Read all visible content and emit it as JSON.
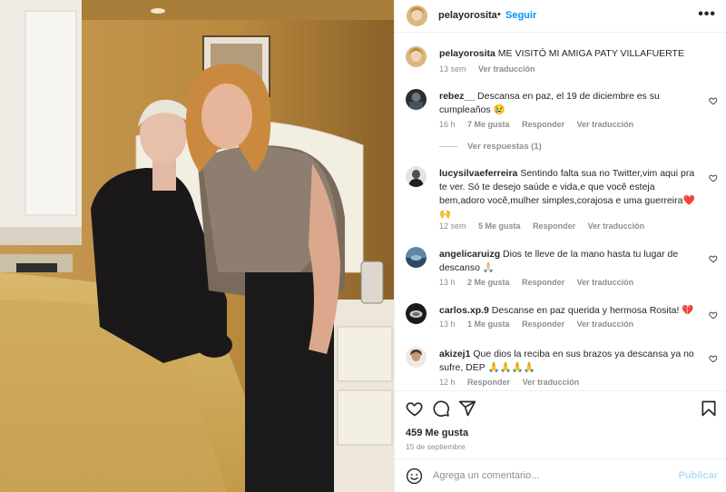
{
  "post": {
    "username": "pelayorosita",
    "separator": "•",
    "follow_label": "Seguir",
    "more_label": "•••"
  },
  "caption": {
    "username": "pelayorosita",
    "text": "ME VISITÓ MI AMIGA PATY VILLAFUERTE",
    "time": "13 sem",
    "translate": "Ver traducción"
  },
  "comments": [
    {
      "username": "rebez__",
      "text": "Descansa en paz, el 19 de diciembre es su cumpleaños 😢",
      "time": "16 h",
      "likes": "7 Me gusta",
      "reply": "Responder",
      "translate": "Ver traducción",
      "view_replies": "Ver respuestas (1)"
    },
    {
      "username": "lucysilvaeferreira",
      "text": "Sentindo falta sua no Twitter,vim aqui pra te ver. Só te desejo saúde e vida,e que você esteja bem,adoro você,mulher simples,corajosa e uma guerreira❤️🙌",
      "time": "12 sem",
      "likes": "5 Me gusta",
      "reply": "Responder",
      "translate": "Ver traducción"
    },
    {
      "username": "angelicaruizg",
      "text": "Dios te lleve de la mano hasta tu lugar de descanso 🙏🏻",
      "time": "13 h",
      "likes": "2 Me gusta",
      "reply": "Responder",
      "translate": "Ver traducción"
    },
    {
      "username": "carlos.xp.9",
      "text": "Descanse en paz querida y hermosa Rosita! 💔",
      "time": "13 h",
      "likes": "1 Me gusta",
      "reply": "Responder",
      "translate": "Ver traducción"
    },
    {
      "username": "akizej1",
      "text": "Que dios la reciba en sus brazos ya descansa ya no sufre, DEP 🙏🙏🙏🙏",
      "time": "12 h",
      "reply": "Responder",
      "translate": "Ver traducción"
    }
  ],
  "footer": {
    "likes": "459 Me gusta",
    "date": "15 de septiembre",
    "comment_placeholder": "Agrega un comentario...",
    "publish_label": "Publicar"
  },
  "icons": {
    "like": "heart-icon",
    "comment": "comment-icon",
    "share": "share-icon",
    "save": "bookmark-icon",
    "emoji": "emoji-icon"
  },
  "colors": {
    "accent": "#0095f6",
    "publish_disabled": "#b2dffc",
    "muted": "#8e8e8e"
  }
}
